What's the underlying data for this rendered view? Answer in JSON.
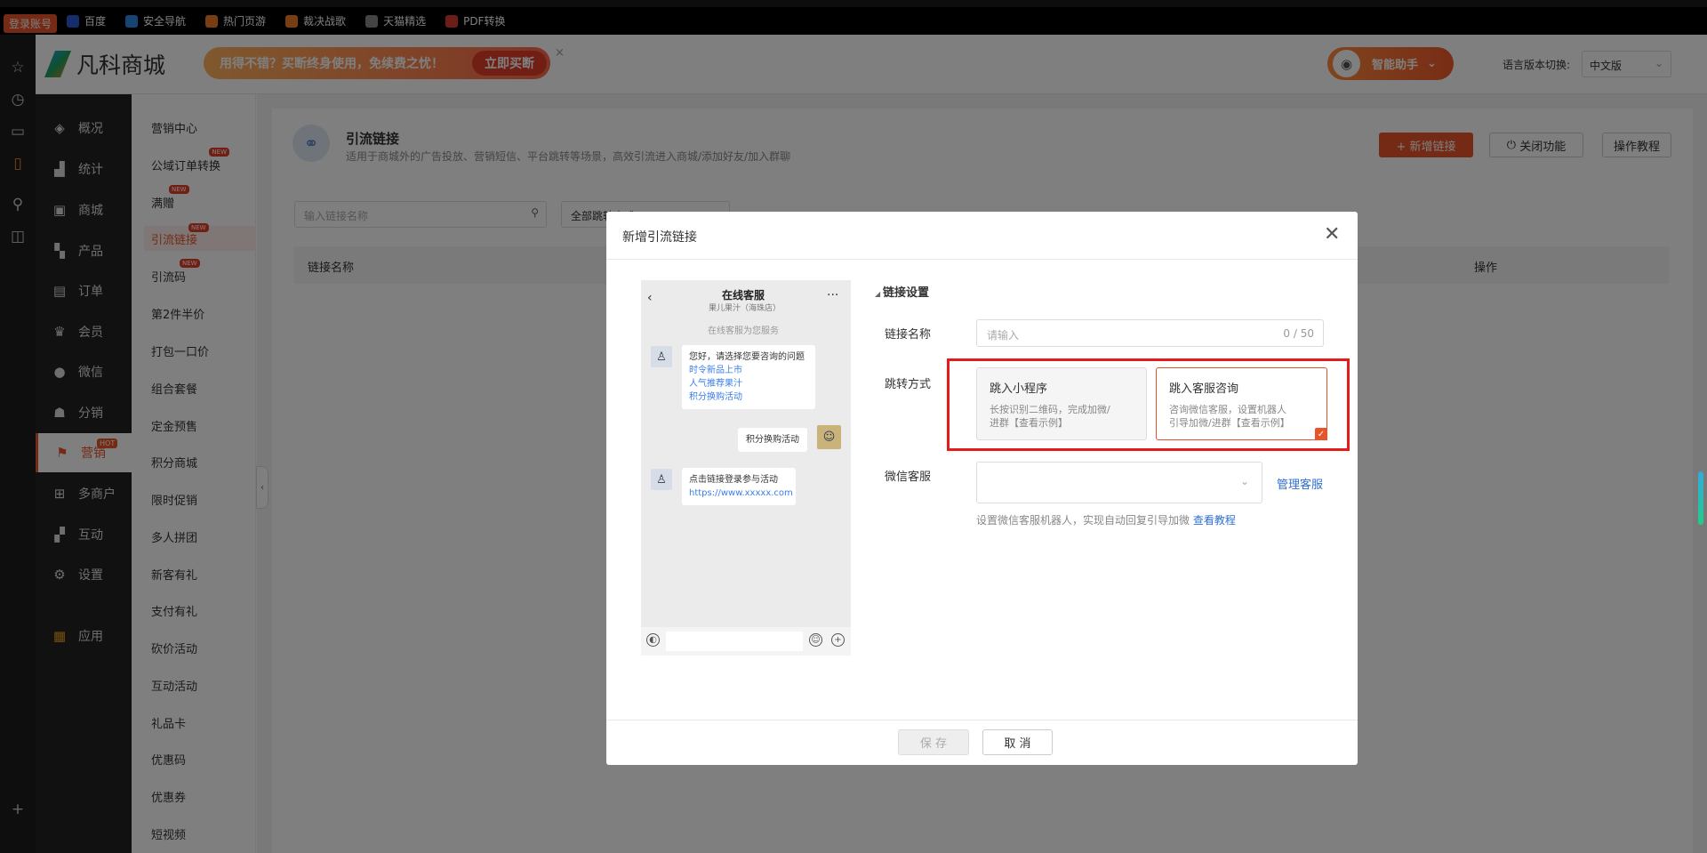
{
  "browser": {
    "login_tag": "登录账号",
    "bookmarks": [
      {
        "label": "百度",
        "color": "#2b5bd7"
      },
      {
        "label": "安全导航",
        "color": "#2b8be6"
      },
      {
        "label": "热门页游",
        "color": "#f07a22"
      },
      {
        "label": "裁决战歌",
        "color": "#f07a22"
      },
      {
        "label": "天猫精选",
        "color": "#888888"
      },
      {
        "label": "PDF转换",
        "color": "#d83a2e"
      }
    ]
  },
  "header": {
    "logo_text": "凡科商城",
    "promo_text": "用得不错？买断终身使用，免续费之忧！",
    "promo_button": "立即买断",
    "promo_close": "×",
    "assistant_label": "智能助手",
    "lang_label": "语言版本切换:",
    "lang_value": "中文版"
  },
  "nav_primary": [
    {
      "label": "概况",
      "icon": "layers-icon",
      "glyph": "◈"
    },
    {
      "label": "统计",
      "icon": "chart-icon",
      "glyph": "▟"
    },
    {
      "label": "商城",
      "icon": "store-icon",
      "glyph": "▣"
    },
    {
      "label": "产品",
      "icon": "grid-icon",
      "glyph": "▚"
    },
    {
      "label": "订单",
      "icon": "order-icon",
      "glyph": "▤"
    },
    {
      "label": "会员",
      "icon": "crown-icon",
      "glyph": "♛"
    },
    {
      "label": "微信",
      "icon": "wechat-icon",
      "glyph": "●"
    },
    {
      "label": "分销",
      "icon": "users-icon",
      "glyph": "☗"
    },
    {
      "label": "营销",
      "icon": "flag-icon",
      "glyph": "⚑",
      "badge": "HOT"
    },
    {
      "label": "多商户",
      "icon": "merchant-icon",
      "glyph": "⊞"
    },
    {
      "label": "互动",
      "icon": "interact-icon",
      "glyph": "▞"
    },
    {
      "label": "设置",
      "icon": "gear-icon",
      "glyph": "⚙"
    },
    {
      "label": "应用",
      "icon": "apps-icon",
      "glyph": "▦"
    }
  ],
  "nav_secondary": [
    {
      "label": "营销中心"
    },
    {
      "label": "公域订单转换",
      "badge": "NEW"
    },
    {
      "label": "满赠",
      "badge": "NEW"
    },
    {
      "label": "引流链接",
      "badge": "NEW"
    },
    {
      "label": "引流码",
      "badge": "NEW"
    },
    {
      "label": "第2件半价"
    },
    {
      "label": "打包一口价"
    },
    {
      "label": "组合套餐"
    },
    {
      "label": "定金预售"
    },
    {
      "label": "积分商城"
    },
    {
      "label": "限时促销"
    },
    {
      "label": "多人拼团"
    },
    {
      "label": "新客有礼"
    },
    {
      "label": "支付有礼"
    },
    {
      "label": "砍价活动"
    },
    {
      "label": "互动活动"
    },
    {
      "label": "礼品卡"
    },
    {
      "label": "优惠码"
    },
    {
      "label": "优惠券"
    },
    {
      "label": "短视频"
    }
  ],
  "page": {
    "title": "引流链接",
    "desc": "适用于商城外的广告投放、营销短信、平台跳转等场景，高效引流进入商城/添加好友/加入群聊",
    "add_button": "+ 新增链接",
    "close_button": "关闭功能",
    "tutorial_button": "操作教程",
    "search_placeholder": "输入链接名称",
    "filter_value": "全部跳转方式",
    "col_name": "链接名称",
    "col_action": "操作"
  },
  "modal": {
    "title": "新增引流链接",
    "section": "链接设置",
    "name_label": "链接名称",
    "name_placeholder": "请输入",
    "name_count": "0 / 50",
    "jump_label": "跳转方式",
    "option1_title": "跳入小程序",
    "option1_desc1": "长按识别二维码，完成加微/",
    "option1_desc2": "进群【查看示例】",
    "option2_title": "跳入客服咨询",
    "option2_desc1": "咨询微信客服，设置机器人",
    "option2_desc2": "引导加微/进群【查看示例】",
    "wx_label": "微信客服",
    "manage_link": "管理客服",
    "hint": "设置微信客服机器人，实现自动回复引导加微",
    "hint_link": "查看教程",
    "save": "保 存",
    "cancel": "取 消"
  },
  "phone": {
    "title": "在线客服",
    "subtitle": "果儿果汁（海珠店）",
    "serve_note": "在线客服为您服务",
    "msg1_line1": "您好，请选择您要咨询的问题",
    "msg1_links": [
      "时令新品上市",
      "人气推荐果汁",
      "积分换购活动"
    ],
    "msg_user": "积分换购活动",
    "msg2_line1": "点击链接登录参与活动",
    "msg2_link": "https://www.xxxxx.com"
  },
  "colors": {
    "accent": "#e8542a",
    "highlight_frame": "#e51b1b",
    "link": "#2e6fd1"
  }
}
